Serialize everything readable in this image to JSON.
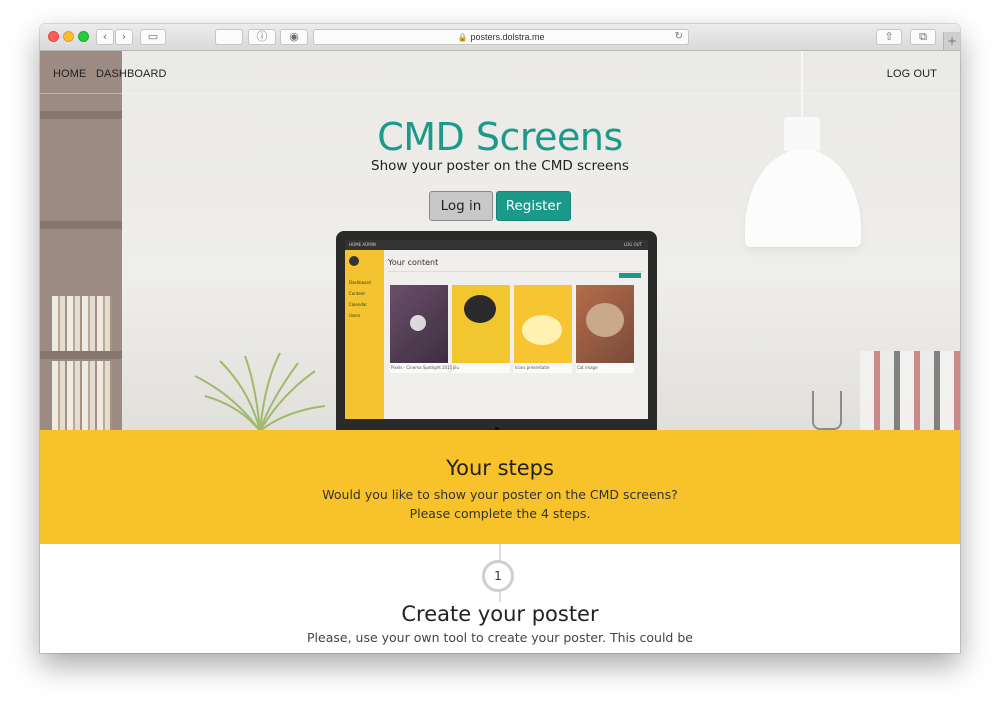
{
  "browser": {
    "url": "posters.dolstra.me",
    "icons": [
      "back-icon",
      "forward-icon",
      "sidebar-icon",
      "info-icon",
      "extension-icon",
      "lock-icon",
      "reload-icon",
      "share-icon",
      "tabs-icon",
      "plus-icon"
    ]
  },
  "nav": {
    "home": "HOME",
    "dashboard": "DASHBOARD",
    "logout": "LOG OUT"
  },
  "hero": {
    "title": "CMD Screens",
    "subtitle": "Show your poster on the CMD screens",
    "login_label": "Log in",
    "register_label": "Register"
  },
  "mockup": {
    "nav_left": "HOME   ADMIN",
    "nav_right": "LOG OUT",
    "heading": "Your content",
    "sidebar": [
      "Dashboard",
      "Content",
      "Calendar",
      "Users"
    ],
    "cards": [
      {
        "caption": "Pixels - Cinema Spotlight 2015..."
      },
      {
        "caption": "Jilu"
      },
      {
        "caption": "Icons presentatie"
      },
      {
        "caption": "Cat image"
      }
    ]
  },
  "steps": {
    "title": "Your steps",
    "text": "Would you like to show your poster on the CMD screens? Please complete the 4 steps."
  },
  "step1": {
    "number": "1",
    "title": "Create your poster",
    "text": "Please, use your own tool to create your poster. This could be"
  },
  "colors": {
    "accent": "#1b998b",
    "steps_bg": "#f8c22b"
  }
}
